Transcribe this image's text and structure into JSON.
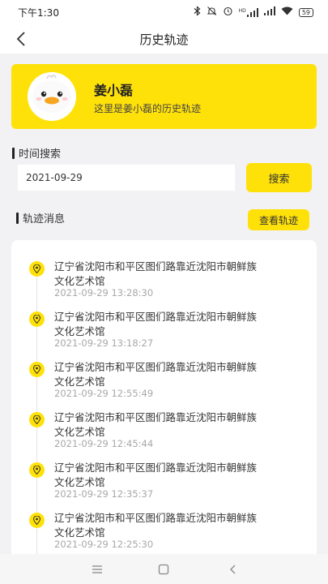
{
  "status_bar": {
    "time": "下午1:30",
    "signal_text": "HD",
    "battery": "59",
    "icons": [
      "bluetooth-icon",
      "mute-icon",
      "alarm-icon",
      "signal-icon",
      "signal-icon",
      "wifi-icon",
      "battery-icon"
    ]
  },
  "header": {
    "title": "历史轨迹",
    "back_icon": "chevron-left-icon"
  },
  "profile": {
    "name": "姜小磊",
    "description": "这里是姜小磊的历史轨迹",
    "avatar_icon": "duck-avatar"
  },
  "search": {
    "section_label": "时间搜索",
    "date_value": "2021-09-29",
    "button_label": "搜索"
  },
  "tracks": {
    "section_label": "轨迹消息",
    "view_button_label": "查看轨迹",
    "items": [
      {
        "address_line1": "辽宁省沈阳市和平区图们路靠近沈阳市朝鲜族",
        "address_line2": "文化艺术馆",
        "time": "2021-09-29 13:28:30"
      },
      {
        "address_line1": "辽宁省沈阳市和平区图们路靠近沈阳市朝鲜族",
        "address_line2": "文化艺术馆",
        "time": "2021-09-29 13:18:27"
      },
      {
        "address_line1": "辽宁省沈阳市和平区图们路靠近沈阳市朝鲜族",
        "address_line2": "文化艺术馆",
        "time": "2021-09-29 12:55:49"
      },
      {
        "address_line1": "辽宁省沈阳市和平区图们路靠近沈阳市朝鲜族",
        "address_line2": "文化艺术馆",
        "time": "2021-09-29 12:45:44"
      },
      {
        "address_line1": "辽宁省沈阳市和平区图们路靠近沈阳市朝鲜族",
        "address_line2": "文化艺术馆",
        "time": "2021-09-29 12:35:37"
      },
      {
        "address_line1": "辽宁省沈阳市和平区图们路靠近沈阳市朝鲜族",
        "address_line2": "文化艺术馆",
        "time": "2021-09-29 12:25:30"
      }
    ]
  },
  "colors": {
    "accent": "#ffe10a",
    "background": "#f2f2f4",
    "muted_text": "#a8a8a8"
  }
}
